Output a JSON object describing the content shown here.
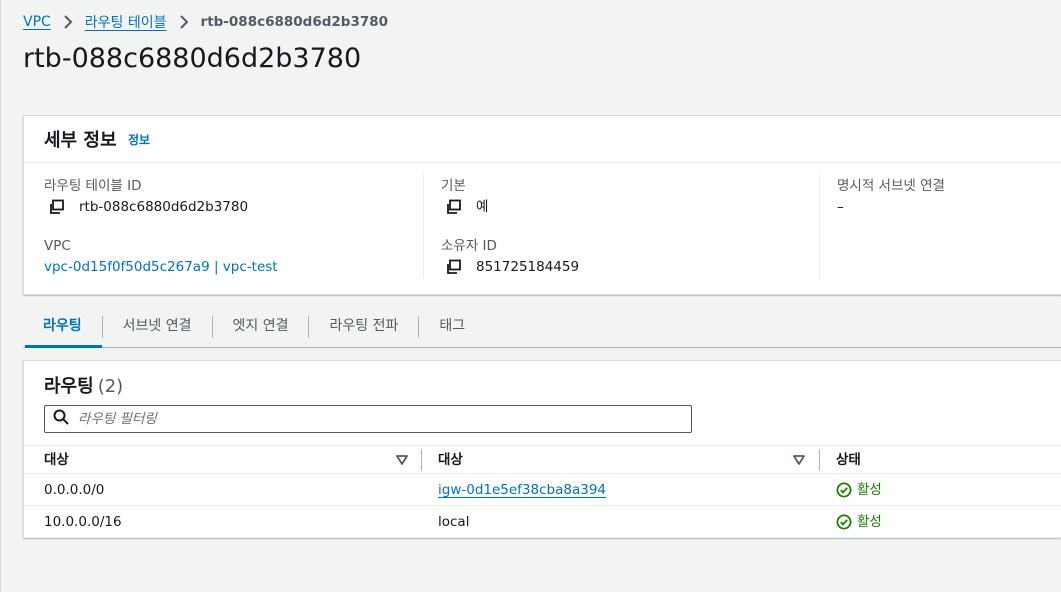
{
  "breadcrumb": {
    "items": [
      {
        "label": "VPC"
      },
      {
        "label": "라우팅 테이블"
      },
      {
        "label": "rtb-088c6880d6d2b3780"
      }
    ]
  },
  "page": {
    "title": "rtb-088c6880d6d2b3780"
  },
  "details": {
    "title": "세부 정보",
    "info_link": "정보",
    "route_table_id": {
      "label": "라우팅 테이블 ID",
      "value": "rtb-088c6880d6d2b3780"
    },
    "vpc": {
      "label": "VPC",
      "value": "vpc-0d15f0f50d5c267a9 | vpc-test"
    },
    "main": {
      "label": "기본",
      "value": "예"
    },
    "owner_id": {
      "label": "소유자 ID",
      "value": "851725184459"
    },
    "explicit_subnets": {
      "label": "명시적 서브넷 연결",
      "value": "–"
    }
  },
  "tabs": [
    {
      "label": "라우팅",
      "active": true
    },
    {
      "label": "서브넷 연결",
      "active": false
    },
    {
      "label": "엣지 연결",
      "active": false
    },
    {
      "label": "라우팅 전파",
      "active": false
    },
    {
      "label": "태그",
      "active": false
    }
  ],
  "routes": {
    "title": "라우팅",
    "count": "(2)",
    "search_placeholder": "라우팅 필터링",
    "columns": [
      "대상",
      "대상",
      "상태"
    ],
    "rows": [
      {
        "destination": "0.0.0.0/0",
        "target": "igw-0d1e5ef38cba8a394",
        "target_is_link": true,
        "status": "활성"
      },
      {
        "destination": "10.0.0.0/16",
        "target": "local",
        "target_is_link": false,
        "status": "활성"
      }
    ]
  },
  "colors": {
    "link": "#0073bb",
    "success": "#1d8102",
    "background": "#f2f3f3"
  },
  "icons": {
    "breadcrumb_separator": "chevron-right-icon",
    "copy": "copy-icon",
    "search": "search-icon",
    "sort": "sort-down-icon",
    "status": "check-circle-icon"
  }
}
